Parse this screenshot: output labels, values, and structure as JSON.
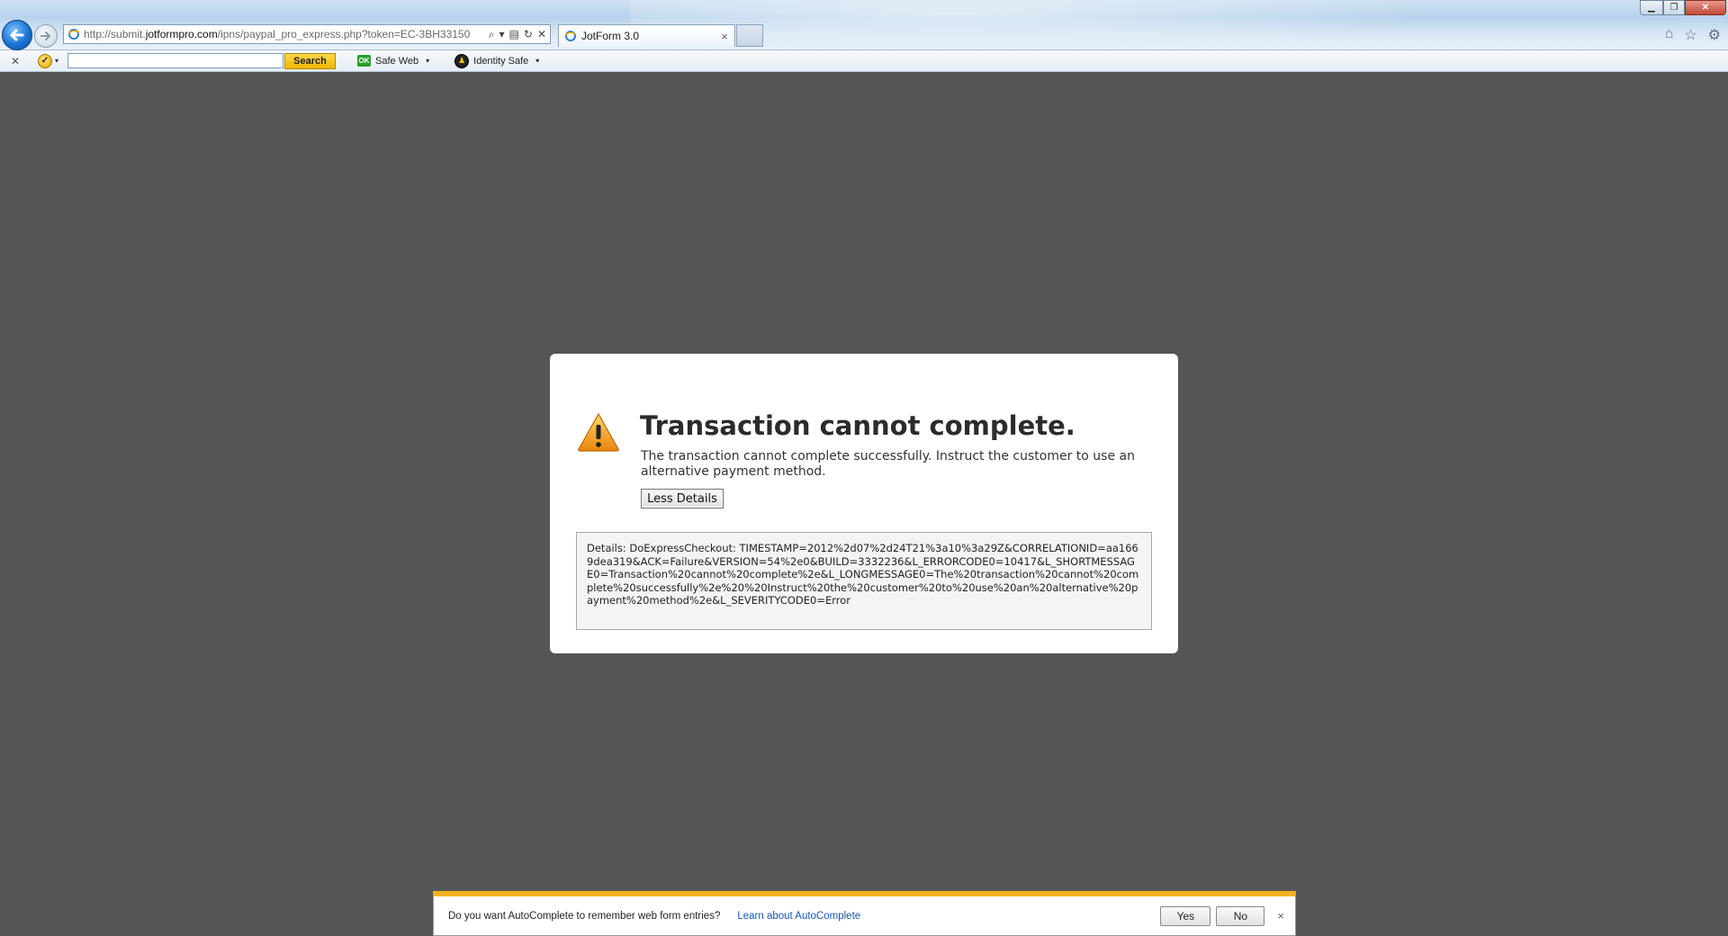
{
  "browser": {
    "url_prefix": "http://submit.",
    "url_domain": "jotformpro.com",
    "url_suffix": "/ipns/paypal_pro_express.php?token=EC-3BH33150",
    "tab_title": "JotForm 3.0",
    "tab_close": "×",
    "new_tab": "",
    "window_controls": {
      "minimize": "▁",
      "maximize": "❐",
      "close": "✕"
    },
    "right_icons": {
      "home": "⌂",
      "favorites": "☆",
      "tools": "⚙"
    },
    "address_tools": {
      "search": "⌕",
      "dropdown": "▾",
      "compat": "▤",
      "refresh": "↻",
      "stop": "✕"
    }
  },
  "toolbar": {
    "close": "✕",
    "norton_mark": "✓",
    "norton_dropdown": "▾",
    "search_value": "",
    "search_button": "Search",
    "safeweb_badge": "OK",
    "safeweb_label": "Safe Web",
    "identity_glyph": "♟",
    "identity_label": "Identity Safe",
    "dropdown": "▾"
  },
  "dialog": {
    "title": "Transaction cannot complete.",
    "message": "The transaction cannot complete successfully. Instruct the customer to use an alternative payment method.",
    "less_details_button": "Less Details",
    "details": "Details: DoExpressCheckout: TIMESTAMP=2012%2d07%2d24T21%3a10%3a29Z&CORRELATIONID=aa1669dea319&ACK=Failure&VERSION=54%2e0&BUILD=3332236&L_ERRORCODE0=10417&L_SHORTMESSAGE0=Transaction%20cannot%20complete%2e&L_LONGMESSAGE0=The%20transaction%20cannot%20complete%20successfully%2e%20%20Instruct%20the%20customer%20to%20use%20an%20alternative%20payment%20method%2e&L_SEVERITYCODE0=Error"
  },
  "autocomplete": {
    "question": "Do you want AutoComplete to remember web form entries?",
    "link": "Learn about AutoComplete",
    "yes": "Yes",
    "no": "No",
    "close": "×"
  },
  "colors": {
    "page_background": "#555555",
    "warning_accent": "#f2b21c",
    "link": "#1a55b0"
  }
}
